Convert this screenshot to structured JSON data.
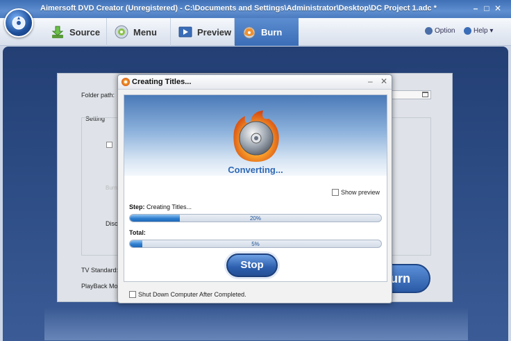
{
  "window": {
    "title": "Aimersoft DVD Creator (Unregistered) - C:\\Documents and Settings\\Administrator\\Desktop\\DC Project 1.adc *",
    "min_glyph": "–",
    "max_glyph": "□",
    "close_glyph": "✕"
  },
  "toolbar": {
    "tabs": [
      {
        "label": "Source"
      },
      {
        "label": "Menu"
      },
      {
        "label": "Preview"
      },
      {
        "label": "Burn"
      }
    ],
    "option_label": "Option",
    "help_label": "Help ▾",
    "active_tab": "Burn"
  },
  "burn_panel": {
    "folder_path_label": "Folder path:",
    "setting_label": "Setting",
    "faint_label_1": "Burn",
    "faint_label_2": "Disc",
    "tv_standard_label": "TV Standard:",
    "playback_mode_label": "PlayBack Mode",
    "burn_button_label": "urn"
  },
  "dialog": {
    "title": "Creating Titles...",
    "min_glyph": "–",
    "close_glyph": "✕",
    "status": "Converting...",
    "show_preview_label": "Show preview",
    "step_label": "Step:",
    "step_value": "Creating Titles...",
    "step_percent_text": "20%",
    "step_progress": 20,
    "total_label": "Total:",
    "total_percent_text": "5%",
    "total_progress": 5,
    "stop_label": "Stop",
    "shutdown_label": "Shut Down Computer After Completed."
  },
  "colors": {
    "accent": "#2e68b5",
    "progress_fill": "#2f7fd0",
    "workspace": "#2e4d86"
  },
  "icons": [
    "app-logo-icon",
    "source-download-icon",
    "menu-disc-icon",
    "preview-film-icon",
    "burn-flame-icon",
    "gear-icon",
    "help-icon",
    "folder-icon",
    "disc-flame-icon"
  ]
}
